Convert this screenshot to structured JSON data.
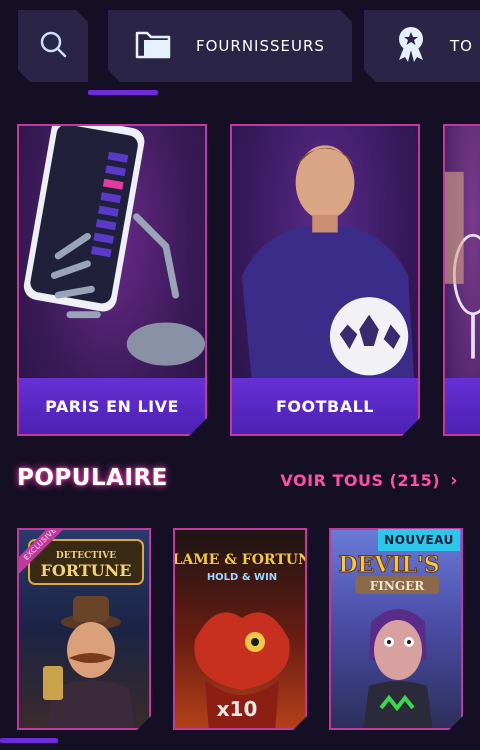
{
  "tabs": [
    {
      "label": "",
      "icon": "search-icon"
    },
    {
      "label": "FOURNISSEURS",
      "icon": "folder-icon"
    },
    {
      "label": "TO",
      "icon": "award-badge-icon"
    }
  ],
  "categories": [
    {
      "label": "PARIS EN LIVE"
    },
    {
      "label": "FOOTBALL"
    },
    {
      "label": ""
    }
  ],
  "popular": {
    "title": "POPULAIRE",
    "see_all": "VOIR TOUS (215)"
  },
  "games": [
    {
      "title": "DETECTIVE FORTUNE",
      "badge": "EXCLUSIVE"
    },
    {
      "title": "FLAME & FORTUNE",
      "subtitle": "HOLD & WIN",
      "multiplier": "x10"
    },
    {
      "title": "DEVIL'S FINGER",
      "badge": "NOUVEAU"
    }
  ],
  "colors": {
    "accent_purple": "#6e2bd9",
    "accent_pink": "#ff4fa8",
    "card_border": "#c0399d",
    "new_badge": "#2ec6e8"
  }
}
